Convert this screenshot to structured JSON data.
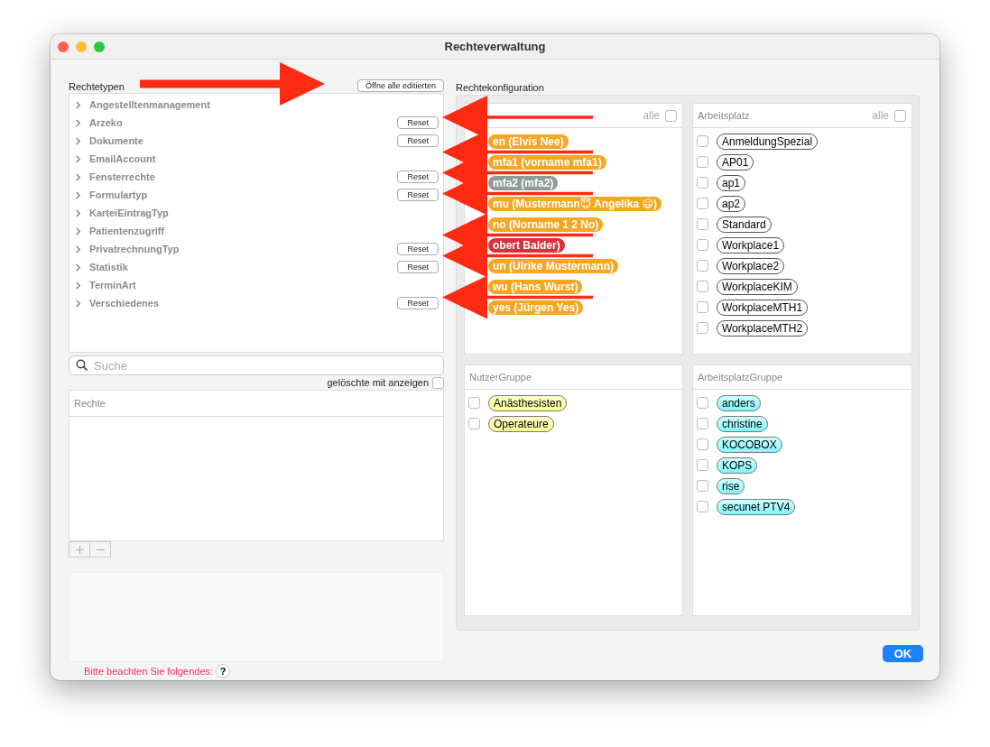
{
  "window": {
    "title": "Rechteverwaltung"
  },
  "rights_types": {
    "label": "Rechtetypen",
    "open_all_button": "Öffne alle editierten",
    "items": [
      {
        "label": "Angestelltenmanagement",
        "expanded": false
      },
      {
        "label": "Arzeko",
        "expanded": false,
        "reset": "Reset"
      },
      {
        "label": "Dokumente",
        "expanded": false,
        "reset": "Reset"
      },
      {
        "label": "EmailAccount",
        "expanded": false
      },
      {
        "label": "Fensterrechte",
        "expanded": false,
        "reset": "Reset"
      },
      {
        "label": "Formulartyp",
        "expanded": false,
        "reset": "Reset"
      },
      {
        "label": "KarteiEintragTyp",
        "expanded": false
      },
      {
        "label": "Patientenzugriff",
        "expanded": false
      },
      {
        "label": "PrivatrechnungTyp",
        "expanded": false,
        "reset": "Reset"
      },
      {
        "label": "Statistik",
        "expanded": false,
        "reset": "Reset"
      },
      {
        "label": "TerminArt",
        "expanded": false
      },
      {
        "label": "Verschiedenes",
        "expanded": false,
        "reset": "Reset"
      }
    ]
  },
  "search": {
    "placeholder": "Suche"
  },
  "show_deleted": {
    "label": "gelöschte mit anzeigen",
    "checked": false
  },
  "rights_table": {
    "columns": [
      "Rechte"
    ]
  },
  "notice": {
    "label": "Bitte beachten Sie folgendes:",
    "help": "?"
  },
  "configuration": {
    "label": "Rechtekonfiguration",
    "panels": [
      {
        "kind": "users",
        "select_all": {
          "label": "alle",
          "checked": false
        },
        "items": [
          {
            "label": "en (Elvis Nee)",
            "color": "#f5a623"
          },
          {
            "label": "mfa1 (vorname mfa1)",
            "color": "#f5a623"
          },
          {
            "label": "mfa2 (mfa2)",
            "color": "#8e9b9b"
          },
          {
            "label": "mu (Mustermann😇 Angelika 😃)",
            "color": "#f5a623"
          },
          {
            "label": "no (Norname 1 2 No)",
            "color": "#f5a623"
          },
          {
            "label": "obert Balder)",
            "color": "#d8303c"
          },
          {
            "label": "un (Ulrike Mustermann)",
            "color": "#f5a623"
          },
          {
            "label": "wu (Hans Wurst)",
            "color": "#f5a623"
          },
          {
            "label": "yes (Jürgen Yes)",
            "color": "#f5a623"
          }
        ]
      },
      {
        "kind": "workplaces",
        "title": "Arbeitsplatz",
        "select_all": {
          "label": "alle",
          "checked": false
        },
        "items": [
          {
            "label": "AnmeldungSpezial",
            "checked": false
          },
          {
            "label": "AP01",
            "checked": false
          },
          {
            "label": "ap1",
            "checked": false
          },
          {
            "label": "ap2",
            "checked": false
          },
          {
            "label": "Standard",
            "checked": false
          },
          {
            "label": "Workplace1",
            "checked": false
          },
          {
            "label": "Workplace2",
            "checked": false
          },
          {
            "label": "WorkplaceKIM",
            "checked": false
          },
          {
            "label": "WorkplaceMTH1",
            "checked": false
          },
          {
            "label": "WorkplaceMTH2",
            "checked": false
          }
        ]
      },
      {
        "kind": "user_groups",
        "title": "NutzerGruppe",
        "items": [
          {
            "label": "Anästhesisten",
            "checked": false
          },
          {
            "label": "Operateure",
            "checked": false
          }
        ]
      },
      {
        "kind": "workplace_groups",
        "title": "ArbeitsplatzGruppe",
        "items": [
          {
            "label": "anders",
            "checked": false
          },
          {
            "label": "christine",
            "checked": false
          },
          {
            "label": "KOCOBOX",
            "checked": false
          },
          {
            "label": "KOPS",
            "checked": false
          },
          {
            "label": "rise",
            "checked": false
          },
          {
            "label": "secunet PTV4",
            "checked": false
          }
        ]
      }
    ]
  },
  "ok_button": "OK",
  "annotations": [
    {
      "kind": "arrow_right"
    },
    {
      "kind": "arrow_left"
    },
    {
      "kind": "arrow_left"
    },
    {
      "kind": "arrow_left"
    },
    {
      "kind": "arrow_left"
    },
    {
      "kind": "arrow_left"
    },
    {
      "kind": "arrow_left"
    },
    {
      "kind": "arrow_left"
    }
  ]
}
